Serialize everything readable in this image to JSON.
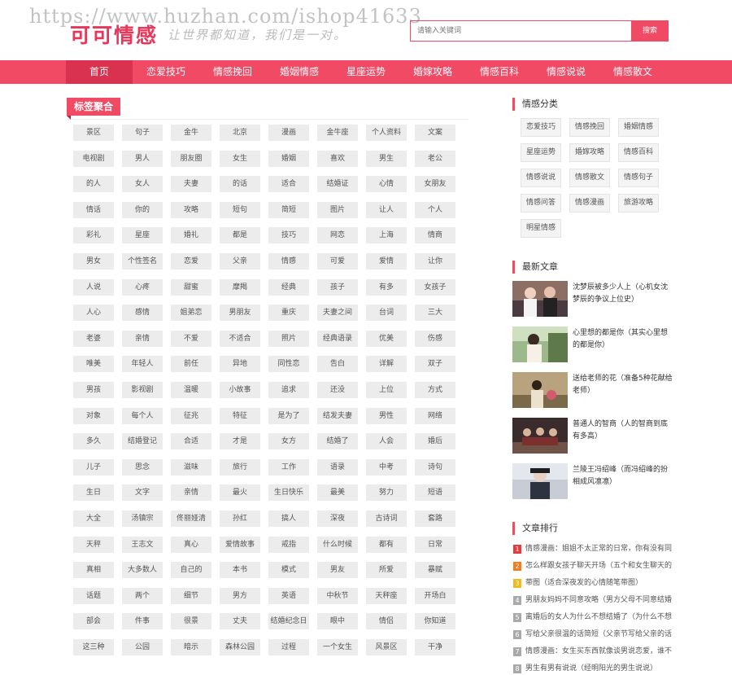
{
  "watermark": "https://www.huzhan.com/ishop41633",
  "site": {
    "logo": "可可情感",
    "slogan": "让世界都知道，我们是一对。"
  },
  "search": {
    "placeholder": "请输入关键词",
    "button": "搜索"
  },
  "nav": [
    "首页",
    "恋爱技巧",
    "情感挽回",
    "婚姻情感",
    "星座运势",
    "婚嫁攻略",
    "情感百科",
    "情感说说",
    "情感散文"
  ],
  "tags_title": "标签聚合",
  "tags": [
    "景区",
    "句子",
    "金牛",
    "北京",
    "漫画",
    "金牛座",
    "个人资料",
    "文案",
    "电视剧",
    "男人",
    "朋友圈",
    "女生",
    "婚姻",
    "喜欢",
    "男生",
    "老公",
    "的人",
    "女人",
    "夫妻",
    "的话",
    "适合",
    "结婚证",
    "心情",
    "女朋友",
    "情话",
    "你的",
    "攻略",
    "短句",
    "简短",
    "图片",
    "让人",
    "个人",
    "彩礼",
    "星座",
    "婚礼",
    "都是",
    "技巧",
    "网恋",
    "上海",
    "情商",
    "男女",
    "个性签名",
    "恋爱",
    "父亲",
    "情感",
    "可爱",
    "爱情",
    "让你",
    "人说",
    "心疼",
    "甜蜜",
    "摩羯",
    "经典",
    "孩子",
    "有多",
    "女孩子",
    "人心",
    "感情",
    "姐弟恋",
    "男朋友",
    "重庆",
    "夫妻之间",
    "台词",
    "三大",
    "老婆",
    "亲情",
    "不爱",
    "不适合",
    "照片",
    "经典语录",
    "优美",
    "伤感",
    "唯美",
    "年轻人",
    "前任",
    "异地",
    "同性恋",
    "告白",
    "详解",
    "双子",
    "男孩",
    "影视剧",
    "温暖",
    "小故事",
    "追求",
    "还没",
    "上位",
    "方式",
    "对象",
    "每个人",
    "征兆",
    "特征",
    "是为了",
    "结发夫妻",
    "男性",
    "网络",
    "多久",
    "结婚登记",
    "合适",
    "才是",
    "女方",
    "结婚了",
    "人会",
    "婚后",
    "儿子",
    "思念",
    "滋味",
    "旅行",
    "工作",
    "语录",
    "中考",
    "诗句",
    "生日",
    "文字",
    "亲情",
    "最火",
    "生日快乐",
    "最美",
    "努力",
    "短语",
    "大全",
    "汤镇宗",
    "佟丽娅清",
    "孙红",
    "搞人",
    "深夜",
    "古诗词",
    "套路",
    "天秤",
    "王志文",
    "真心",
    "爱情故事",
    "戒指",
    "什么时候",
    "都有",
    "日常",
    "真相",
    "大多数人",
    "自己的",
    "本书",
    "模式",
    "男友",
    "所爱",
    "暴赋",
    "话题",
    "两个",
    "细节",
    "男方",
    "英语",
    "中秋节",
    "天秤座",
    "开场白",
    "部会",
    "件事",
    "很景",
    "丈夫",
    "结婚纪念日",
    "眼中",
    "情侣",
    "你知道",
    "这三种",
    "公园",
    "暗示",
    "森林公园",
    "过程",
    "一个女生",
    "风景区",
    "干净"
  ],
  "sidebar": {
    "categories_title": "情感分类",
    "categories": [
      "恋爱技巧",
      "情感挽回",
      "婚姻情感",
      "星座运势",
      "婚嫁攻略",
      "情感百科",
      "情感说说",
      "情感散文",
      "情感句子",
      "情感问答",
      "情感漫画",
      "旅游攻略",
      "明星情感"
    ],
    "latest_title": "最新文章",
    "latest": [
      "沈梦辰被多少人上（心机女沈梦辰的争议上位史）",
      "心里想的都是你（其实心里想的都是你）",
      "送给老师的花（准备5种花献给老师）",
      "普通人的智商（人的智商到底有多高）",
      "兰陵王冯绍峰（而冯绍峰的扮相成风凛凛）"
    ],
    "ranking_title": "文章排行",
    "ranking": [
      "情感漫画：姐姐不太正常的日常，你有没有同",
      "怎么样跟女孩子聊天开场（五个和女生聊天的",
      "带图（适合深夜发的心情随笔带图）",
      "男朋友妈妈不同意攻略（男方父母不同意结婚",
      "离婚后的女人为什么不想结婚了（为什么不想",
      "写给父亲很温的话简短（父亲节写给父亲的话",
      "情感漫画：女生买东西就像谈男说恋爱，谁不",
      "男生有男有说说（经明阳光的男生说说）"
    ]
  },
  "colors": {
    "accent": "#f04a65",
    "nav_active": "#d93150",
    "rank1": "#e8393b",
    "rank2": "#f57b1f",
    "rank3": "#f5b91f",
    "rank_other": "#a9a9a9"
  }
}
